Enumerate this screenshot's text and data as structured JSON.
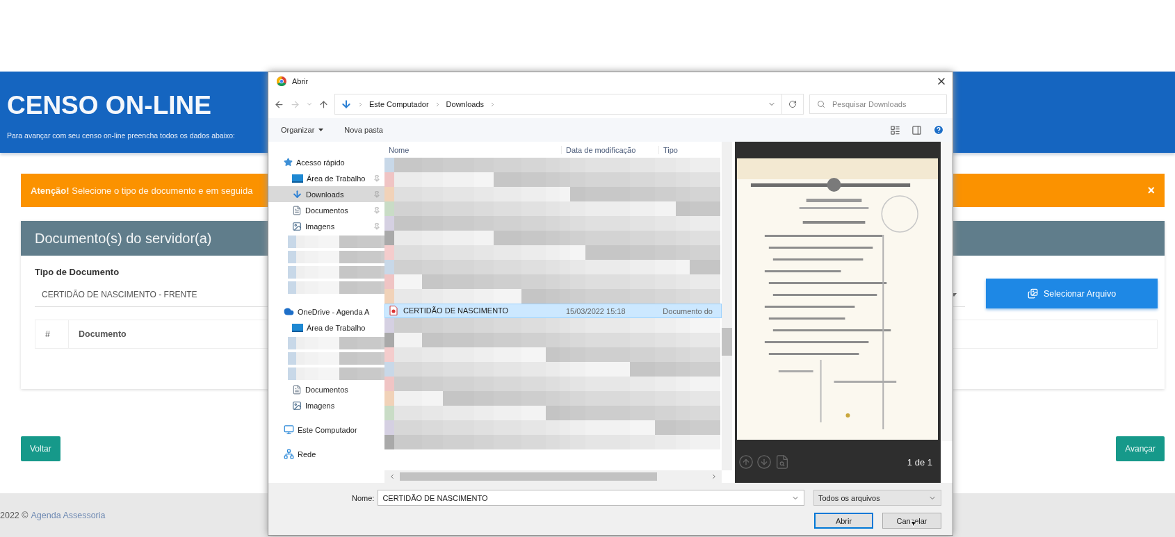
{
  "header": {
    "title": "CENSO ON-LINE",
    "subtitle": "Para avançar com seu censo on-line preencha todos os dados abaixo:"
  },
  "alert": {
    "text": "**Atenção!** Selecione o tipo de documento e em seguida",
    "close": "×"
  },
  "card": {
    "title": "Documento(s) do servidor(a)",
    "field_label": "Tipo de Documento",
    "select_value": "CERTIDÃO DE NASCIMENTO - FRENTE",
    "upload_button": "Selecionar Arquivo",
    "table_columns": [
      "#",
      "Documento"
    ]
  },
  "back_button": "Voltar",
  "next_button": "Avançar",
  "footer": {
    "text": "2022 ©",
    "link": "Agenda Assessoria"
  },
  "dialog": {
    "title": "Abrir",
    "path": [
      "Este Computador",
      "Downloads"
    ],
    "search": {
      "placeholder": "Pesquisar Downloads"
    },
    "toolbar": [
      {
        "label": "Organizar",
        "menu": true
      },
      {
        "label": "Nova pasta",
        "menu": false
      }
    ],
    "nav": [
      {
        "kind": "quick-access",
        "label": "Acesso rápido",
        "pinned": false,
        "selected": false,
        "children": [
          {
            "kind": "desktop",
            "label": "Área de Trabalho",
            "pinned": true,
            "selected": false
          },
          {
            "kind": "downloads",
            "label": "Downloads",
            "pinned": true,
            "selected": true
          },
          {
            "kind": "documents",
            "label": "Documentos",
            "pinned": true,
            "selected": false
          },
          {
            "kind": "pictures",
            "label": "Imagens",
            "pinned": true,
            "selected": false
          },
          {
            "kind": "blurred",
            "selected": false
          },
          {
            "kind": "blurred",
            "selected": false
          },
          {
            "kind": "blurred",
            "selected": false
          },
          {
            "kind": "blurred",
            "selected": false
          }
        ]
      },
      {
        "kind": "cloud",
        "label": "OneDrive - Agenda A",
        "pinned": false,
        "selected": false,
        "children": [
          {
            "kind": "desktop",
            "label": "Área de Trabalho",
            "pinned": false,
            "selected": false
          },
          {
            "kind": "blurred",
            "selected": false
          },
          {
            "kind": "blurred",
            "selected": false
          },
          {
            "kind": "blurred",
            "selected": false
          },
          {
            "kind": "documents",
            "label": "Documentos",
            "pinned": false,
            "selected": false
          },
          {
            "kind": "pictures",
            "label": "Imagens",
            "pinned": false,
            "selected": false
          }
        ]
      },
      {
        "kind": "computer",
        "label": "Este Computador",
        "pinned": false,
        "selected": false
      },
      {
        "kind": "network",
        "label": "Rede",
        "pinned": false,
        "selected": false
      }
    ],
    "columns": [
      "Nome",
      "Data de modificação",
      "Tipo"
    ],
    "files": [
      {
        "kind": "blurred",
        "selected": false
      },
      {
        "kind": "blurred",
        "selected": false
      },
      {
        "kind": "blurred",
        "selected": false
      },
      {
        "kind": "blurred",
        "selected": false
      },
      {
        "kind": "blurred",
        "selected": false
      },
      {
        "kind": "blurred",
        "selected": false
      },
      {
        "kind": "blurred",
        "selected": false
      },
      {
        "kind": "blurred",
        "selected": false
      },
      {
        "kind": "blurred",
        "selected": false
      },
      {
        "kind": "blurred",
        "selected": false
      },
      {
        "kind": "pdf",
        "name": "CERTIDÃO DE NASCIMENTO",
        "date": "15/03/2022 15:18",
        "type": "Documento do",
        "selected": true
      },
      {
        "kind": "blurred",
        "selected": false
      },
      {
        "kind": "blurred",
        "selected": false
      },
      {
        "kind": "blurred",
        "selected": false
      },
      {
        "kind": "blurred",
        "selected": false
      },
      {
        "kind": "blurred",
        "selected": false
      },
      {
        "kind": "blurred",
        "selected": false
      },
      {
        "kind": "blurred",
        "selected": false
      },
      {
        "kind": "blurred",
        "selected": false
      },
      {
        "kind": "blurred",
        "selected": false
      }
    ],
    "preview": {
      "kind": "picture",
      "page_counter": "1 de 1"
    },
    "filename": {
      "label": "Nome:",
      "value": "CERTIDÃO DE NASCIMENTO"
    },
    "filter": "Todos os arquivos",
    "buttons": [
      {
        "label": "Abrir",
        "default": true
      },
      {
        "label": "Cancelar",
        "default": false
      }
    ]
  }
}
